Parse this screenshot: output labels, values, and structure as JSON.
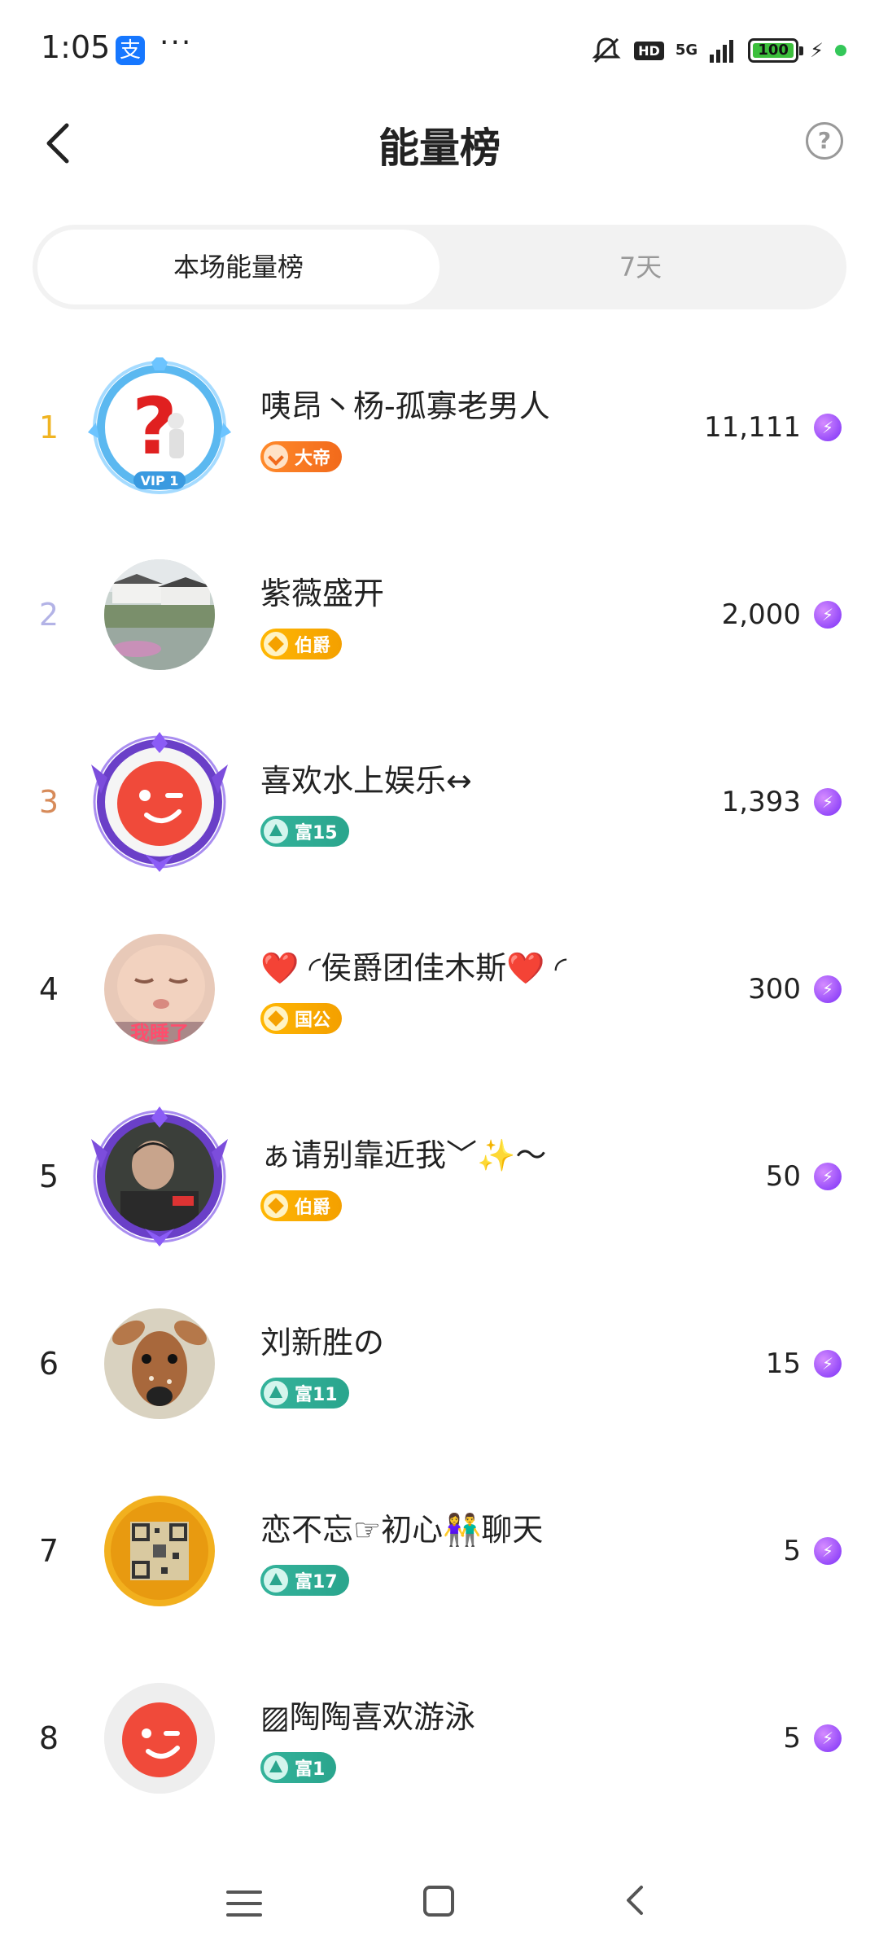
{
  "status_bar": {
    "time": "1:05",
    "alipay_glyph": "支",
    "overflow": "···",
    "hd": "HD",
    "network": "5G",
    "battery": "100",
    "battery_color": "#3cbf3c"
  },
  "header": {
    "title": "能量榜",
    "help_glyph": "?"
  },
  "tabs": [
    {
      "label": "本场能量榜",
      "active": true
    },
    {
      "label": "7天",
      "active": false
    }
  ],
  "ranking": [
    {
      "rank": "1",
      "rank_color": "#f0b422",
      "name": "咦昂丶杨-孤寡老男人",
      "badge": "大帝",
      "badge_style": "orange",
      "score": "11,111",
      "avatar": "vip-question-avatar",
      "frame": "vip-frame"
    },
    {
      "rank": "2",
      "rank_color": "#b3b3e6",
      "name": "紫薇盛开",
      "badge": "伯爵",
      "badge_style": "gold",
      "score": "2,000",
      "avatar": "village-photo-avatar",
      "frame": ""
    },
    {
      "rank": "3",
      "rank_color": "#d78b5a",
      "name": "喜欢水上娱乐↔",
      "badge": "富15",
      "badge_style": "teal",
      "score": "1,393",
      "avatar": "wink-logo-avatar",
      "frame": "purple-frame"
    },
    {
      "rank": "4",
      "rank_color": "#222222",
      "name": "❤️ ◜侯爵团佳木斯❤️ ◜",
      "badge": "国公",
      "badge_style": "gold",
      "score": "300",
      "avatar": "baby-photo-avatar",
      "frame": ""
    },
    {
      "rank": "5",
      "rank_color": "#222222",
      "name": "ぁ请别靠近我﹀✨～",
      "badge": "伯爵",
      "badge_style": "gold",
      "score": "50",
      "avatar": "person-photo-avatar",
      "frame": "purple-frame"
    },
    {
      "rank": "6",
      "rank_color": "#222222",
      "name": "刘新胜の",
      "badge": "富11",
      "badge_style": "teal",
      "score": "15",
      "avatar": "deer-photo-avatar",
      "frame": ""
    },
    {
      "rank": "7",
      "rank_color": "#222222",
      "name": "恋不忘☞初心👫聊天",
      "badge": "富17",
      "badge_style": "teal",
      "score": "5",
      "avatar": "qr-sunflower-avatar",
      "frame": ""
    },
    {
      "rank": "8",
      "rank_color": "#222222",
      "name": "▨陶陶喜欢游泳",
      "badge": "富1",
      "badge_style": "teal",
      "score": "5",
      "avatar": "wink-logo-avatar",
      "frame": ""
    }
  ],
  "colors": {
    "accent_purple": "#7b2ff7",
    "tab_bg": "#f2f2f2",
    "inactive_text": "#999999"
  }
}
